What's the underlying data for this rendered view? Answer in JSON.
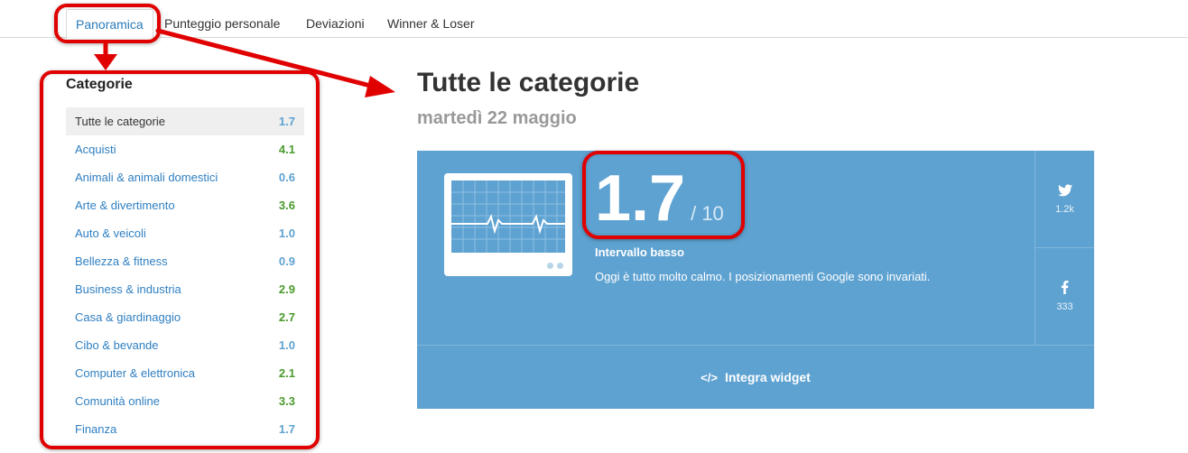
{
  "tabs": [
    {
      "label": "Panoramica",
      "active": true
    },
    {
      "label": "Punteggio personale",
      "active": false
    },
    {
      "label": "Deviazioni",
      "active": false
    },
    {
      "label": "Winner & Loser",
      "active": false
    }
  ],
  "sidebar": {
    "title": "Categorie",
    "items": [
      {
        "label": "Tutte le categorie",
        "value": "1.7",
        "color": "#5ea2d1"
      },
      {
        "label": "Acquisti",
        "value": "4.1",
        "color": "#4a9a2c"
      },
      {
        "label": "Animali & animali domestici",
        "value": "0.6",
        "color": "#5ea2d1"
      },
      {
        "label": "Arte & divertimento",
        "value": "3.6",
        "color": "#4a9a2c"
      },
      {
        "label": "Auto & veicoli",
        "value": "1.0",
        "color": "#5ea2d1"
      },
      {
        "label": "Bellezza & fitness",
        "value": "0.9",
        "color": "#5ea2d1"
      },
      {
        "label": "Business & industria",
        "value": "2.9",
        "color": "#4a9a2c"
      },
      {
        "label": "Casa & giardinaggio",
        "value": "2.7",
        "color": "#4a9a2c"
      },
      {
        "label": "Cibo & bevande",
        "value": "1.0",
        "color": "#5ea2d1"
      },
      {
        "label": "Computer & elettronica",
        "value": "2.1",
        "color": "#4a9a2c"
      },
      {
        "label": "Comunità online",
        "value": "3.3",
        "color": "#4a9a2c"
      },
      {
        "label": "Finanza",
        "value": "1.7",
        "color": "#5ea2d1"
      }
    ]
  },
  "main": {
    "title": "Tutte le categorie",
    "date": "martedì 22 maggio",
    "score": "1.7",
    "score_max": "/ 10",
    "range_label": "Intervallo basso",
    "description": "Oggi è tutto molto calmo. I posizionamenti Google sono invariati.",
    "twitter_icon": "twitter-icon",
    "twitter_count": "1.2k",
    "facebook_icon": "facebook-icon",
    "facebook_count": "333",
    "widget_icon": "code-icon",
    "widget_label": "Integra widget",
    "panel_color": "#5ea2d1"
  },
  "annotations": {
    "highlight_color": "#e00000"
  }
}
